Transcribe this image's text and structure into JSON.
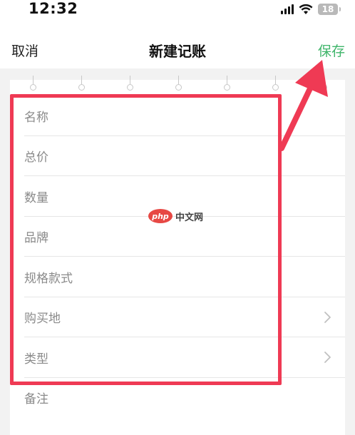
{
  "status_bar": {
    "time": "12:32",
    "battery_level": "18"
  },
  "nav": {
    "cancel_label": "取消",
    "title": "新建记账",
    "save_label": "保存",
    "save_color": "#3fb56a"
  },
  "form": {
    "fields": [
      {
        "label": "名称",
        "has_chevron": false
      },
      {
        "label": "总价",
        "has_chevron": false
      },
      {
        "label": "数量",
        "has_chevron": false
      },
      {
        "label": "品牌",
        "has_chevron": false
      },
      {
        "label": "规格款式",
        "has_chevron": false
      },
      {
        "label": "购买地",
        "has_chevron": true
      },
      {
        "label": "类型",
        "has_chevron": true
      },
      {
        "label": "备注",
        "has_chevron": false
      }
    ]
  },
  "annotation": {
    "highlight_color": "#ef3a54"
  },
  "watermark": {
    "logo_text": "php",
    "text": "中文网"
  }
}
